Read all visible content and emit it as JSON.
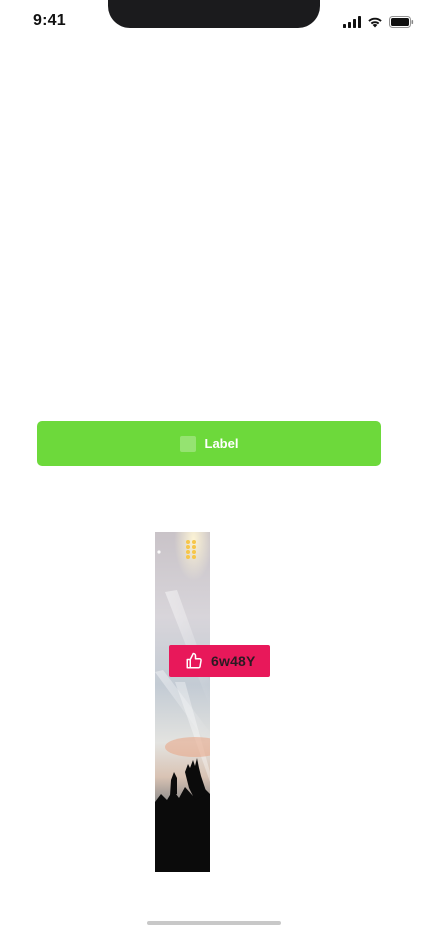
{
  "status_bar": {
    "time": "9:41",
    "icons": [
      "cellular-signal-icon",
      "wifi-icon",
      "battery-icon"
    ]
  },
  "primary_button": {
    "label": "Label",
    "color": "#6dd93b",
    "icon": "placeholder-square-icon"
  },
  "media": {
    "image": "concert-crowd-photo",
    "badge": {
      "icon": "thumbs-up-icon",
      "code": "6w48Y",
      "color": "#e8185a"
    }
  },
  "colors": {
    "background": "#ffffff",
    "home_indicator": "#c8c8c8"
  }
}
